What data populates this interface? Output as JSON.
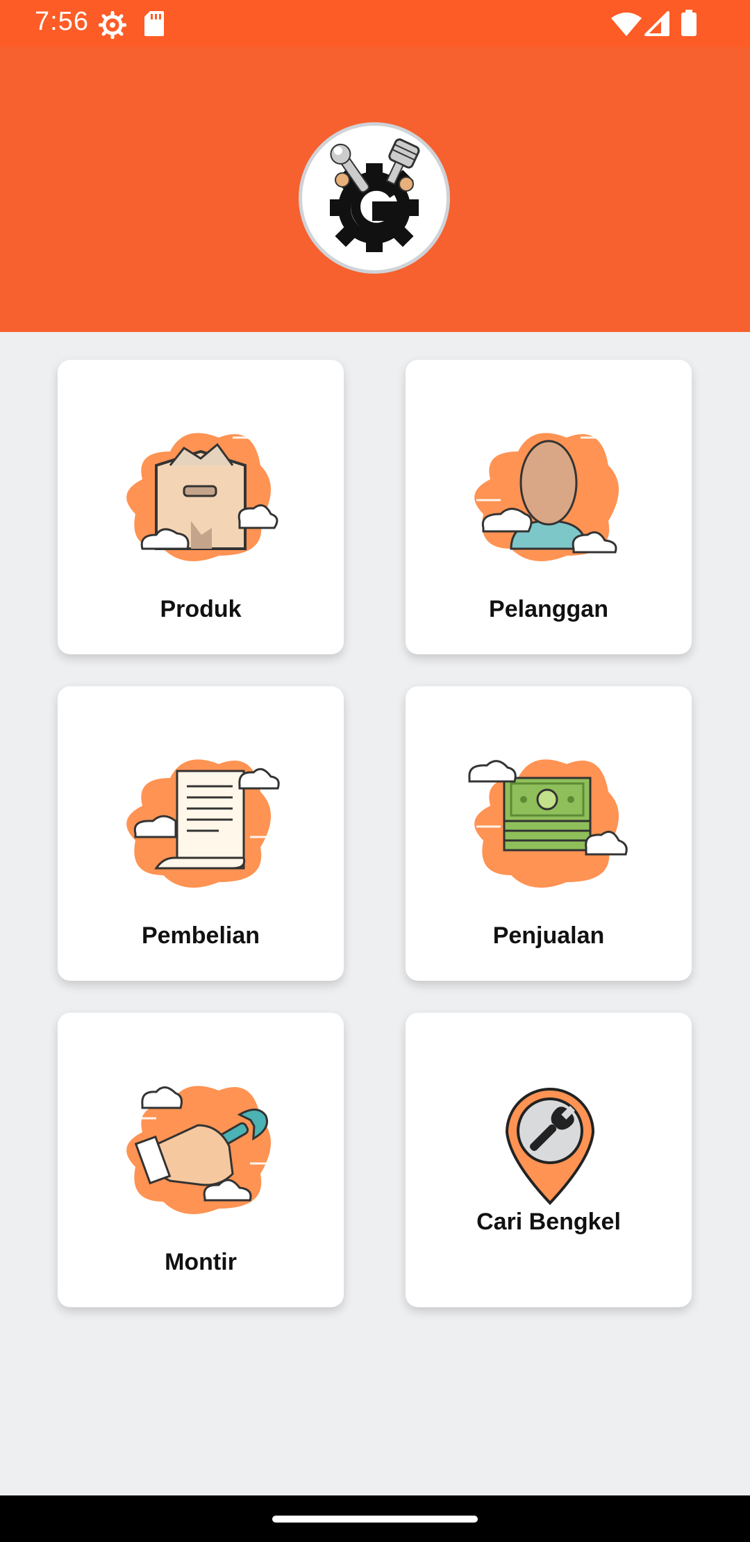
{
  "status_bar": {
    "time": "7:56",
    "icons": [
      "settings-gear-icon",
      "sd-card-icon",
      "wifi-icon",
      "cellular-signal-icon",
      "battery-icon"
    ]
  },
  "header": {
    "logo": "bengkel-g-logo",
    "colors": {
      "header_bg": "#f6612f",
      "status_bg": "#fe5c26",
      "accent_blob": "#fe9353"
    }
  },
  "menu": [
    {
      "label": "Produk",
      "icon": "package-box-icon"
    },
    {
      "label": "Pelanggan",
      "icon": "customer-person-icon"
    },
    {
      "label": "Pembelian",
      "icon": "receipt-scroll-icon"
    },
    {
      "label": "Penjualan",
      "icon": "money-stack-icon"
    },
    {
      "label": "Montir",
      "icon": "mechanic-wrench-hand-icon"
    },
    {
      "label": "Cari Bengkel",
      "icon": "workshop-location-pin-icon"
    }
  ]
}
